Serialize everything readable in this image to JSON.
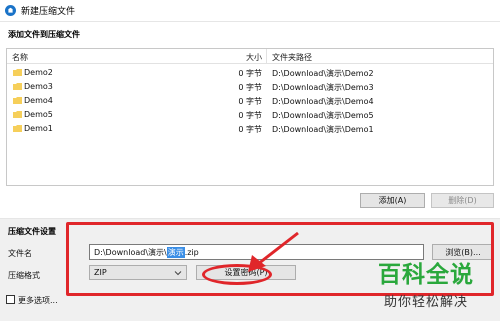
{
  "window": {
    "title": "新建压缩文件"
  },
  "add_section": {
    "heading": "添加文件到压缩文件",
    "columns": {
      "name": "名称",
      "size": "大小",
      "path": "文件夹路径"
    },
    "rows": [
      {
        "name": "Demo2",
        "size": "0 字节",
        "path": "D:\\Download\\演示\\Demo2"
      },
      {
        "name": "Demo3",
        "size": "0 字节",
        "path": "D:\\Download\\演示\\Demo3"
      },
      {
        "name": "Demo4",
        "size": "0 字节",
        "path": "D:\\Download\\演示\\Demo4"
      },
      {
        "name": "Demo5",
        "size": "0 字节",
        "path": "D:\\Download\\演示\\Demo5"
      },
      {
        "name": "Demo1",
        "size": "0 字节",
        "path": "D:\\Download\\演示\\Demo1"
      }
    ],
    "add_label": "添加(A)",
    "delete_label": "删除(D)"
  },
  "settings": {
    "heading": "压缩文件设置",
    "filename_label": "文件名",
    "filename_prefix": "D:\\Download\\演示\\",
    "filename_selected": "演示",
    "filename_suffix": ".zip",
    "browse_label": "浏览(B)...",
    "format_label": "压缩格式",
    "format_value": "ZIP",
    "password_label": "设置密码(P)",
    "more_options_label": "更多选项..."
  },
  "watermark": {
    "title": "百科全说",
    "subtitle": "助你轻松解决"
  },
  "colors": {
    "highlight": "#3a8ee6",
    "annotation": "#e0262a",
    "watermark": "#2aa83c",
    "folder": "#f6cf5a"
  }
}
